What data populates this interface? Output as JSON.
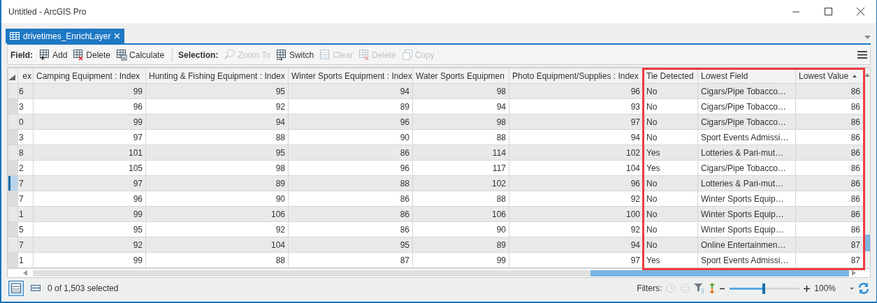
{
  "window": {
    "title": "Untitled - ArcGIS Pro"
  },
  "tabs": [
    {
      "label": "drivetimes_EnrichLayer",
      "selected": true
    }
  ],
  "toolbar": [
    {
      "label": "Field:",
      "items": [
        {
          "label": "Add",
          "kind": "add",
          "disabled": false
        },
        {
          "label": "Delete",
          "kind": "delete",
          "disabled": false
        },
        {
          "label": "Calculate",
          "kind": "calculate",
          "disabled": false
        }
      ]
    },
    {
      "label": "Selection:",
      "items": [
        {
          "label": "Zoom To",
          "kind": "zoom",
          "disabled": true
        },
        {
          "label": "Switch",
          "kind": "switch",
          "disabled": false
        },
        {
          "label": "Clear",
          "kind": "clear",
          "disabled": true
        },
        {
          "label": "Delete",
          "kind": "delete",
          "disabled": true
        },
        {
          "label": "Copy",
          "kind": "copy",
          "disabled": true
        }
      ]
    }
  ],
  "table": {
    "columns": [
      {
        "label": "ex",
        "kind": "number",
        "highlighted": false
      },
      {
        "label": "Camping Equipment : Index",
        "kind": "number",
        "highlighted": false
      },
      {
        "label": "Hunting & Fishing Equipment : Index",
        "kind": "number",
        "highlighted": false
      },
      {
        "label": "Winter Sports Equipment : Index",
        "kind": "number",
        "highlighted": false
      },
      {
        "label": "Water Sports Equipmen",
        "kind": "number",
        "highlighted": false
      },
      {
        "label": "Photo Equipment/Supplies : Index",
        "kind": "number",
        "highlighted": false
      },
      {
        "label": "Tie Detected",
        "kind": "text",
        "highlighted": true
      },
      {
        "label": "Lowest Field",
        "kind": "text",
        "highlighted": true
      },
      {
        "label": "Lowest Value",
        "kind": "number",
        "highlighted": true,
        "sorted": true
      }
    ],
    "rows": [
      {
        "current": false,
        "cells": [
          "6",
          "99",
          "95",
          "94",
          "98",
          "96",
          "No",
          "Cigars/Pipe Tobacco…",
          "86"
        ]
      },
      {
        "current": false,
        "cells": [
          "3",
          "96",
          "92",
          "89",
          "94",
          "93",
          "No",
          "Cigars/Pipe Tobacco…",
          "86"
        ]
      },
      {
        "current": false,
        "cells": [
          "0",
          "99",
          "94",
          "96",
          "98",
          "97",
          "No",
          "Cigars/Pipe Tobacco…",
          "86"
        ]
      },
      {
        "current": false,
        "cells": [
          "3",
          "97",
          "88",
          "90",
          "88",
          "94",
          "No",
          "Sport Events Admissi…",
          "86"
        ]
      },
      {
        "current": false,
        "cells": [
          "8",
          "101",
          "95",
          "86",
          "114",
          "102",
          "Yes",
          "Lotteries & Pari-mut…",
          "86"
        ]
      },
      {
        "current": false,
        "cells": [
          "2",
          "105",
          "98",
          "96",
          "117",
          "104",
          "Yes",
          "Cigars/Pipe Tobacco…",
          "86"
        ]
      },
      {
        "current": true,
        "cells": [
          "7",
          "97",
          "89",
          "88",
          "102",
          "96",
          "No",
          "Lotteries & Pari-mut…",
          "86"
        ]
      },
      {
        "current": false,
        "cells": [
          "7",
          "96",
          "90",
          "86",
          "88",
          "92",
          "No",
          "Winter Sports Equip…",
          "86"
        ]
      },
      {
        "current": false,
        "cells": [
          "1",
          "99",
          "106",
          "86",
          "106",
          "100",
          "No",
          "Winter Sports Equip…",
          "86"
        ]
      },
      {
        "current": false,
        "cells": [
          "5",
          "95",
          "92",
          "86",
          "90",
          "92",
          "No",
          "Winter Sports Equip…",
          "86"
        ]
      },
      {
        "current": false,
        "cells": [
          "7",
          "92",
          "104",
          "95",
          "89",
          "94",
          "No",
          "Online Entertainmen…",
          "87"
        ]
      },
      {
        "current": false,
        "cells": [
          "1",
          "99",
          "88",
          "87",
          "99",
          "97",
          "Yes",
          "Sport Events Admissi…",
          "87"
        ]
      }
    ]
  },
  "status_bar": {
    "view_buttons": [
      {
        "selected": true
      },
      {
        "selected": false
      }
    ],
    "selection_text": "0 of 1,503 selected",
    "filters_label": "Filters:",
    "zoom": {
      "level": 0.49,
      "reading": "100%"
    }
  }
}
